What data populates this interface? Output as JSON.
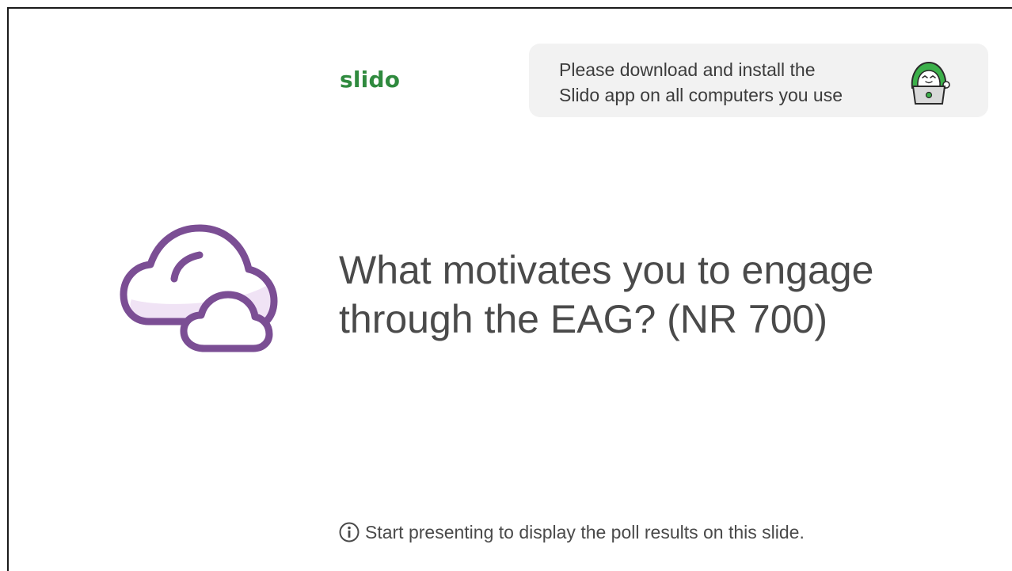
{
  "brand": {
    "logo_text": "slido",
    "color": "#2f8a3e"
  },
  "banner": {
    "message": "Please download and install the\nSlido app on all computers you use",
    "mascot_icon": "slido-mascot-laptop-icon",
    "background": "#f2f2f2"
  },
  "question": {
    "text": "What motivates you to engage\nthrough the EAG? (NR 700)",
    "poll_icon": "word-cloud-icon",
    "icon_color": "#7b4e94",
    "icon_fill": "#f0e3f5"
  },
  "footer": {
    "info_icon": "info-icon",
    "note": "Start presenting to display the poll results on this slide."
  }
}
